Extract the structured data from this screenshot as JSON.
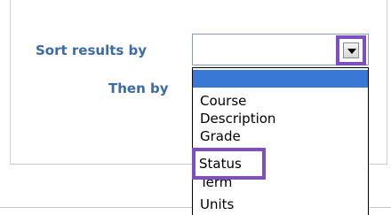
{
  "form": {
    "sort_label": "Sort results by",
    "then_label": "Then by",
    "sort_select_value": ""
  },
  "dropdown": {
    "options": [
      "",
      "Course",
      "Description",
      "Grade",
      "Status",
      "Term",
      "Units"
    ],
    "highlighted_option": ""
  },
  "annotations": {
    "highlight_color": "#7d4fc0"
  },
  "colors": {
    "label": "#3d6aa2",
    "selection": "#3a78d6"
  },
  "icons": {
    "dropdown": "chevron-down-icon"
  }
}
